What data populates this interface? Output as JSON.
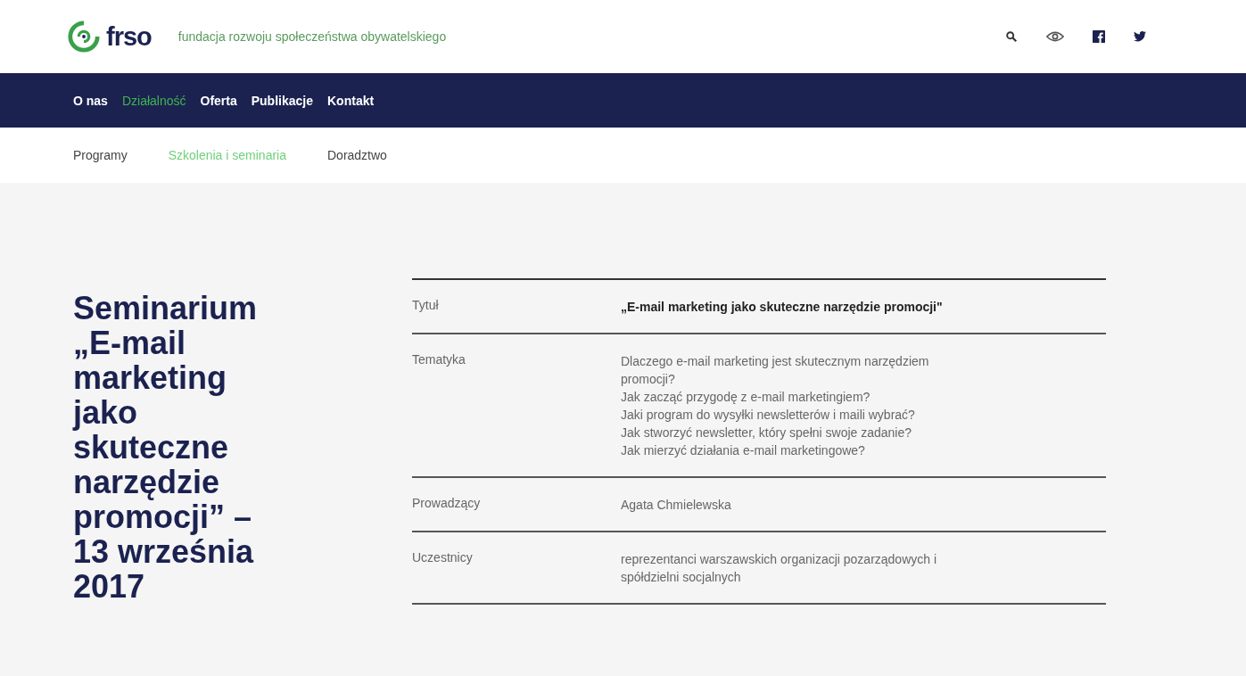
{
  "logo": {
    "name": "frso",
    "tagline": "fundacja rozwoju społeczeństwa obywatelskiego"
  },
  "main_nav": [
    {
      "label": "O nas",
      "selected": false
    },
    {
      "label": "Działalność",
      "selected": true
    },
    {
      "label": "Oferta",
      "selected": false
    },
    {
      "label": "Publikacje",
      "selected": false
    },
    {
      "label": "Kontakt",
      "selected": false
    }
  ],
  "sub_nav": [
    {
      "label": "Programy",
      "selected": false
    },
    {
      "label": "Szkolenia i seminaria",
      "selected": true
    },
    {
      "label": "Doradztwo",
      "selected": false
    }
  ],
  "heading": "Seminarium „E-mail marketing jako skuteczne narzędzie promocji” – 13 września 2017",
  "details": [
    {
      "label": "Tytuł",
      "kind": "bold",
      "lines": [
        "„E-mail marketing jako skuteczne narzędzie promocji\""
      ]
    },
    {
      "label": "Tematyka",
      "kind": "plain",
      "lines": [
        "Dlaczego e-mail marketing jest skutecznym narzędziem",
        "promocji?",
        "Jak zacząć przygodę z e-mail marketingiem?",
        "Jaki program do wysyłki newsletterów i maili wybrać?",
        "Jak stworzyć newsletter, który spełni swoje zadanie?",
        "Jak mierzyć działania e-mail marketingowe?"
      ]
    },
    {
      "label": "Prowadzący",
      "kind": "plain",
      "lines": [
        " Agata Chmielewska"
      ]
    },
    {
      "label": "Uczestnicy",
      "kind": "plain",
      "lines": [
        "reprezentanci warszawskich organizacji pozarządowych i",
        "spółdzielni socjalnych"
      ]
    }
  ]
}
